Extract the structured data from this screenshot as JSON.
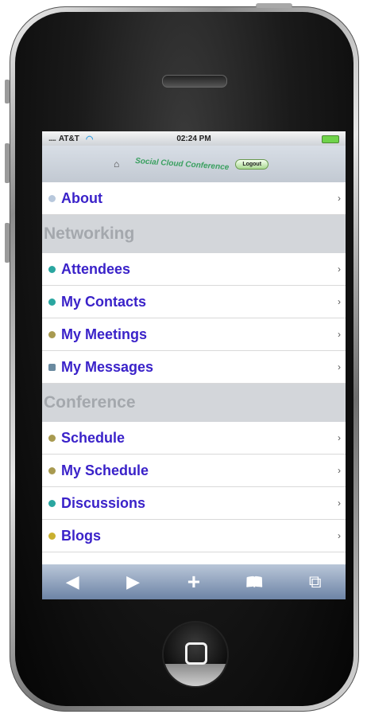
{
  "status": {
    "carrier": "AT&T",
    "time": "02:24 PM"
  },
  "header": {
    "logo_text": "Social Cloud Conference",
    "logout_label": "Logout"
  },
  "menu": {
    "about": {
      "label": "About",
      "chevron": "›",
      "icon": "globe-icon"
    },
    "sections": [
      {
        "title": "Networking",
        "items": [
          {
            "label": "Attendees",
            "icon": "people-icon",
            "icon_color": "#2aa6a0"
          },
          {
            "label": "My Contacts",
            "icon": "contacts-icon",
            "icon_color": "#2aa6a0"
          },
          {
            "label": "My Meetings",
            "icon": "meetings-icon",
            "icon_color": "#a89a50"
          },
          {
            "label": "My Messages",
            "icon": "messages-icon",
            "icon_color": "#6a8aa0"
          }
        ]
      },
      {
        "title": "Conference",
        "items": [
          {
            "label": "Schedule",
            "icon": "schedule-icon",
            "icon_color": "#a89a50"
          },
          {
            "label": "My Schedule",
            "icon": "my-schedule-icon",
            "icon_color": "#a89a50"
          },
          {
            "label": "Discussions",
            "icon": "discussions-icon",
            "icon_color": "#2aa6a0"
          },
          {
            "label": "Blogs",
            "icon": "blogs-icon",
            "icon_color": "#c9b030"
          }
        ]
      }
    ]
  },
  "toolbar": {
    "back": "◀",
    "forward": "▶",
    "add": "+",
    "bookmarks": "📖",
    "pages": "⧉"
  },
  "colors": {
    "link": "#3a22c9",
    "section_bg": "#d3d6da",
    "section_text": "#a4a8ad",
    "toolbar": "#8a9cb8"
  }
}
